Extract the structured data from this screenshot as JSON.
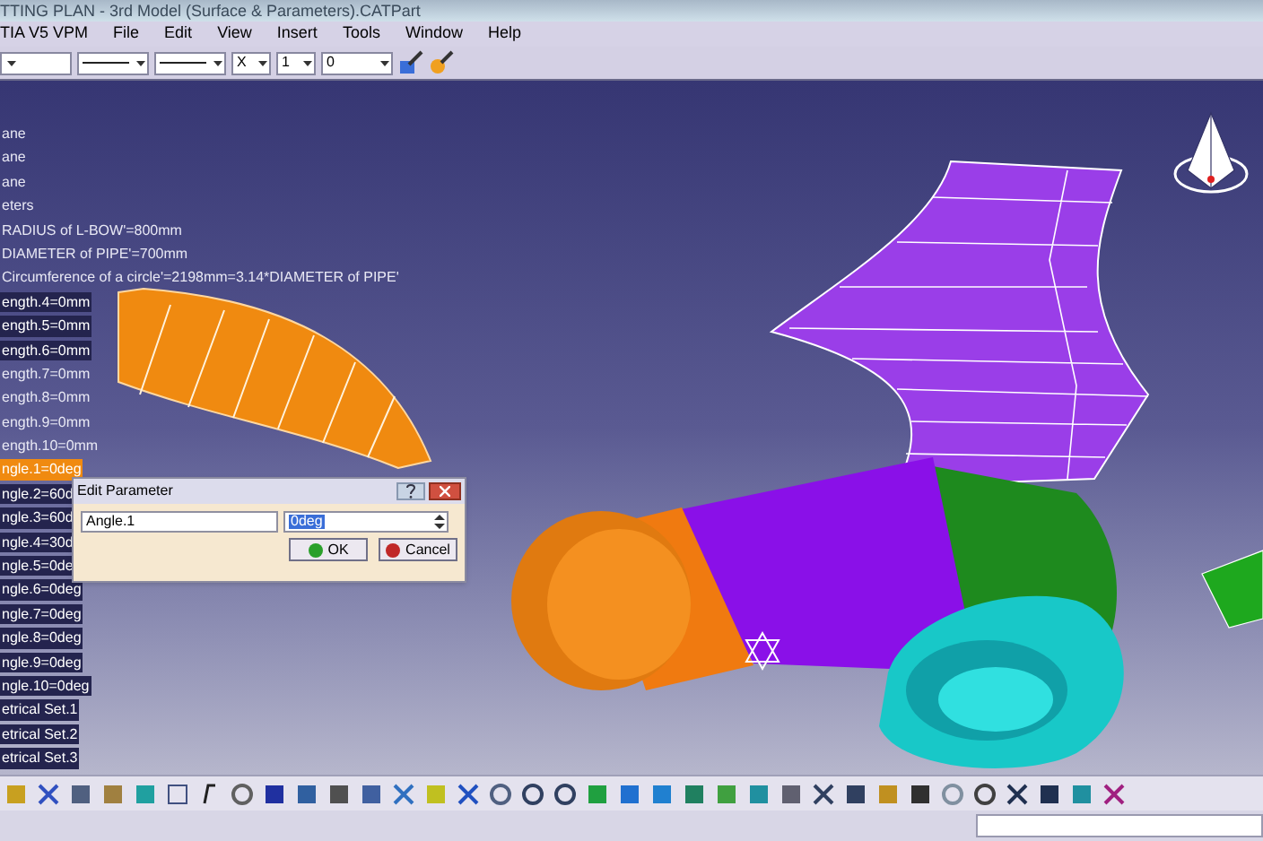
{
  "window": {
    "title": "TTING PLAN - 3rd Model (Surface & Parameters).CATPart"
  },
  "menu": [
    "TIA V5 VPM",
    "File",
    "Edit",
    "View",
    "Insert",
    "Tools",
    "Window",
    "Help"
  ],
  "toolbar": {
    "combos": [
      {
        "kind": "blank"
      },
      {
        "kind": "line"
      },
      {
        "kind": "line"
      },
      {
        "kind": "text",
        "value": "X"
      },
      {
        "kind": "text",
        "value": "1"
      },
      {
        "kind": "text",
        "value": "0"
      }
    ]
  },
  "tree": {
    "items": [
      {
        "label": "ane",
        "highlighted": false,
        "selected": false
      },
      {
        "label": "ane",
        "highlighted": false,
        "selected": false
      },
      {
        "label": "ane",
        "highlighted": false,
        "selected": false
      },
      {
        "label": "eters",
        "highlighted": false,
        "selected": false
      },
      {
        "label": "RADIUS of L-BOW'=800mm",
        "highlighted": false,
        "selected": false
      },
      {
        "label": "DIAMETER of PIPE'=700mm",
        "highlighted": false,
        "selected": false
      },
      {
        "label": "Circumference of a circle'=2198mm=3.14*DIAMETER of PIPE'",
        "highlighted": false,
        "selected": false
      },
      {
        "label": "ength.4=0mm",
        "highlighted": true,
        "selected": false
      },
      {
        "label": "ength.5=0mm",
        "highlighted": true,
        "selected": false
      },
      {
        "label": "ength.6=0mm",
        "highlighted": true,
        "selected": false
      },
      {
        "label": "ength.7=0mm",
        "highlighted": false,
        "selected": false
      },
      {
        "label": "ength.8=0mm",
        "highlighted": false,
        "selected": false
      },
      {
        "label": "ength.9=0mm",
        "highlighted": false,
        "selected": false
      },
      {
        "label": "ength.10=0mm",
        "highlighted": false,
        "selected": false
      },
      {
        "label": "ngle.1=0deg",
        "highlighted": true,
        "selected": true
      },
      {
        "label": "ngle.2=60d",
        "highlighted": true,
        "selected": false
      },
      {
        "label": "ngle.3=60d",
        "highlighted": true,
        "selected": false
      },
      {
        "label": "ngle.4=30d",
        "highlighted": true,
        "selected": false
      },
      {
        "label": "ngle.5=0de",
        "highlighted": true,
        "selected": false
      },
      {
        "label": "ngle.6=0deg",
        "highlighted": true,
        "selected": false
      },
      {
        "label": "ngle.7=0deg",
        "highlighted": true,
        "selected": false
      },
      {
        "label": "ngle.8=0deg",
        "highlighted": true,
        "selected": false
      },
      {
        "label": "ngle.9=0deg",
        "highlighted": true,
        "selected": false
      },
      {
        "label": "ngle.10=0deg",
        "highlighted": true,
        "selected": false
      },
      {
        "label": "etrical Set.1",
        "highlighted": true,
        "selected": false
      },
      {
        "label": "etrical Set.2",
        "highlighted": true,
        "selected": false
      },
      {
        "label": "etrical Set.3",
        "highlighted": true,
        "selected": false
      }
    ]
  },
  "dialog": {
    "title": "Edit Parameter",
    "name": "Angle.1",
    "value": "0deg",
    "buttons": [
      {
        "label": "OK",
        "kind": "ok"
      },
      {
        "label": "Cancel",
        "kind": "cancel"
      }
    ]
  }
}
